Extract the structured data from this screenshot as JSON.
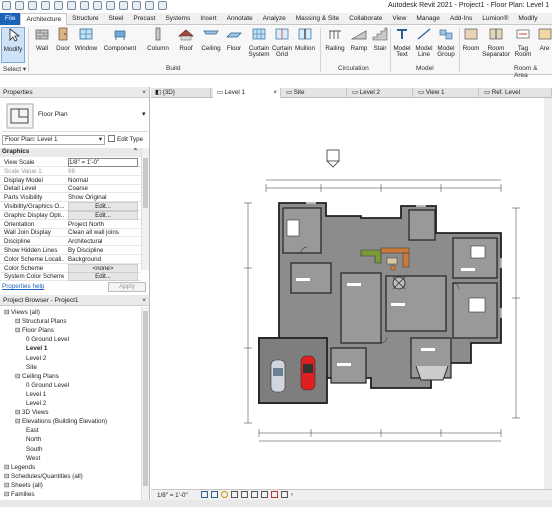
{
  "app": {
    "title": "Autodesk Revit 2021 - Project1 - Floor Plan: Level 1"
  },
  "ribbon_tabs": [
    "File",
    "Architecture",
    "Structure",
    "Steel",
    "Precast",
    "Systems",
    "Insert",
    "Annotate",
    "Analyze",
    "Massing & Site",
    "Collaborate",
    "View",
    "Manage",
    "Add-Ins",
    "Lumion®",
    "Modify"
  ],
  "ribbon": {
    "modify": "Modify",
    "wall": "Wall",
    "door": "Door",
    "window": "Window",
    "component": "Component",
    "column": "Column",
    "roof": "Roof",
    "ceiling": "Ceiling",
    "floor": "Floor",
    "curtain_system": "Curtain System",
    "curtain_grid": "Curtain Grid",
    "mullion": "Mullion",
    "railing": "Railing",
    "ramp": "Ramp",
    "stair": "Stair",
    "model_text": "Model Text",
    "model_line": "Model Line",
    "model_group": "Model Group",
    "room": "Room",
    "room_separator": "Room Separator",
    "tag_room": "Tag Room",
    "area": "Are",
    "panel_select": "Select ▾",
    "panel_build": "Build",
    "panel_circulation": "Circulation",
    "panel_model": "Model",
    "panel_room_area": "Room & Area"
  },
  "properties": {
    "header": "Properties",
    "type_name": "Floor Plan",
    "instance_selector": "Floor Plan: Level 1",
    "edit_type": "Edit Type",
    "group": "Graphics",
    "rows": [
      {
        "k": "View Scale",
        "v": "1/8\" = 1'-0\""
      },
      {
        "k": "Scale Value    1:",
        "v": "96"
      },
      {
        "k": "Display Model",
        "v": "Normal"
      },
      {
        "k": "Detail Level",
        "v": "Coarse"
      },
      {
        "k": "Parts Visibility",
        "v": "Show Original"
      },
      {
        "k": "Visibility/Graphics O...",
        "v": "Edit..."
      },
      {
        "k": "Graphic Display Opti...",
        "v": "Edit..."
      },
      {
        "k": "Orientation",
        "v": "Project North"
      },
      {
        "k": "Wall Join Display",
        "v": "Clean all wall joins"
      },
      {
        "k": "Discipline",
        "v": "Architectural"
      },
      {
        "k": "Show Hidden Lines",
        "v": "By Discipline"
      },
      {
        "k": "Color Scheme Locati...",
        "v": "Background"
      },
      {
        "k": "Color Scheme",
        "v": "<none>"
      },
      {
        "k": "System Color Schemes",
        "v": "Edit..."
      }
    ],
    "help": "Properties help",
    "apply": "Apply"
  },
  "browser": {
    "header": "Project Browser - Project1",
    "nodes": [
      {
        "t": "Views (all)",
        "d": 0
      },
      {
        "t": "Structural Plans",
        "d": 1
      },
      {
        "t": "Floor Plans",
        "d": 1
      },
      {
        "t": "0 Ground Level",
        "d": 2
      },
      {
        "t": "Level 1",
        "d": 2
      },
      {
        "t": "Level 2",
        "d": 2
      },
      {
        "t": "Site",
        "d": 2
      },
      {
        "t": "Ceiling Plans",
        "d": 1
      },
      {
        "t": "0 Ground Level",
        "d": 2
      },
      {
        "t": "Level 1",
        "d": 2
      },
      {
        "t": "Level 2",
        "d": 2
      },
      {
        "t": "3D Views",
        "d": 1
      },
      {
        "t": "Elevations (Building Elevation)",
        "d": 1
      },
      {
        "t": "East",
        "d": 2
      },
      {
        "t": "North",
        "d": 2
      },
      {
        "t": "South",
        "d": 2
      },
      {
        "t": "West",
        "d": 2
      },
      {
        "t": "Legends",
        "d": 0
      },
      {
        "t": "Schedules/Quantities (all)",
        "d": 0
      },
      {
        "t": "Sheets (all)",
        "d": 0
      },
      {
        "t": "Families",
        "d": 0
      }
    ]
  },
  "view_tabs": [
    "{3D}",
    "Level 1",
    "Site",
    "Level 2",
    "View 1",
    "Ref. Level"
  ],
  "viewbar": {
    "scale": "1/8\" = 1'-0\""
  }
}
